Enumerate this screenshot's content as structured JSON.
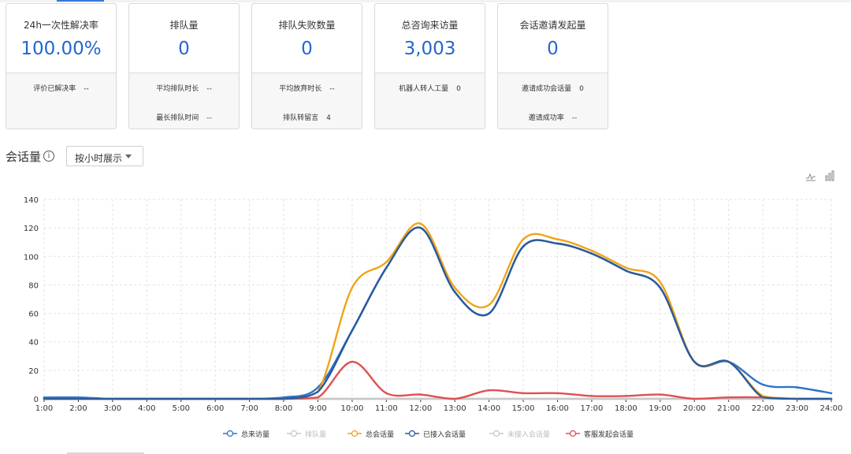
{
  "cards": [
    {
      "title": "24h一次性解决率",
      "value": "100.00%",
      "subs": [
        {
          "label": "评价已解决率",
          "value": "--"
        }
      ]
    },
    {
      "title": "排队量",
      "value": "0",
      "subs": [
        {
          "label": "平均排队时长",
          "value": "--"
        },
        {
          "label": "最长排队时间",
          "value": "--"
        }
      ]
    },
    {
      "title": "排队失败数量",
      "value": "0",
      "subs": [
        {
          "label": "平均放弃时长",
          "value": "--"
        },
        {
          "label": "排队转留言",
          "value": "4"
        }
      ]
    },
    {
      "title": "总咨询来访量",
      "value": "3,003",
      "subs": [
        {
          "label": "机器人转人工量",
          "value": "0"
        }
      ]
    },
    {
      "title": "会话邀请发起量",
      "value": "0",
      "subs": [
        {
          "label": "邀请成功会话量",
          "value": "0"
        },
        {
          "label": "邀请成功率",
          "value": "--"
        }
      ]
    }
  ],
  "section": {
    "title": "会话量",
    "info_icon": "info-circle-icon",
    "dropdown_label": "按小时展示"
  },
  "toolbar": {
    "icons": [
      "line-chart-icon",
      "bar-chart-icon"
    ]
  },
  "chart_data": {
    "type": "line",
    "x": [
      "1:00",
      "2:00",
      "3:00",
      "4:00",
      "5:00",
      "6:00",
      "7:00",
      "8:00",
      "9:00",
      "10:00",
      "11:00",
      "12:00",
      "13:00",
      "14:00",
      "15:00",
      "16:00",
      "17:00",
      "18:00",
      "19:00",
      "20:00",
      "21:00",
      "22:00",
      "23:00",
      "24:00"
    ],
    "ylim": [
      0,
      140
    ],
    "yticks": [
      0,
      20,
      40,
      60,
      80,
      100,
      120,
      140
    ],
    "grid": true,
    "legend_position": "bottom",
    "series": [
      {
        "name": "总来访量",
        "color": "#2f72c9",
        "values": [
          1,
          1,
          0,
          0,
          0,
          0,
          0,
          1,
          8,
          48,
          92,
          120,
          75,
          60,
          107,
          109,
          102,
          90,
          78,
          26,
          26,
          10,
          8,
          4
        ]
      },
      {
        "name": "排队量",
        "color": "#c8c8c8",
        "values": [
          0,
          0,
          0,
          0,
          0,
          0,
          0,
          0,
          0,
          0,
          0,
          0,
          0,
          0,
          0,
          0,
          0,
          0,
          0,
          0,
          0,
          0,
          0,
          0
        ]
      },
      {
        "name": "总会话量",
        "color": "#f0a416",
        "values": [
          0,
          0,
          0,
          0,
          0,
          0,
          0,
          0,
          5,
          78,
          96,
          123,
          78,
          66,
          112,
          112,
          104,
          92,
          82,
          26,
          26,
          2,
          0,
          0
        ]
      },
      {
        "name": "已接入会话量",
        "color": "#2a5a9c",
        "values": [
          0,
          0,
          0,
          0,
          0,
          0,
          0,
          0,
          5,
          48,
          92,
          120,
          75,
          60,
          107,
          109,
          102,
          90,
          78,
          26,
          26,
          1,
          0,
          0
        ]
      },
      {
        "name": "未接入会话量",
        "color": "#c8c8c8",
        "values": [
          0,
          0,
          0,
          0,
          0,
          0,
          0,
          0,
          0,
          0,
          0,
          0,
          0,
          0,
          0,
          0,
          0,
          0,
          0,
          0,
          0,
          0,
          0,
          0
        ]
      },
      {
        "name": "客服发起会话量",
        "color": "#e05050",
        "values": [
          0,
          0,
          0,
          0,
          0,
          0,
          0,
          0,
          1,
          26,
          4,
          3,
          0,
          6,
          4,
          4,
          2,
          2,
          3,
          0,
          1,
          1,
          0,
          0
        ]
      }
    ]
  }
}
